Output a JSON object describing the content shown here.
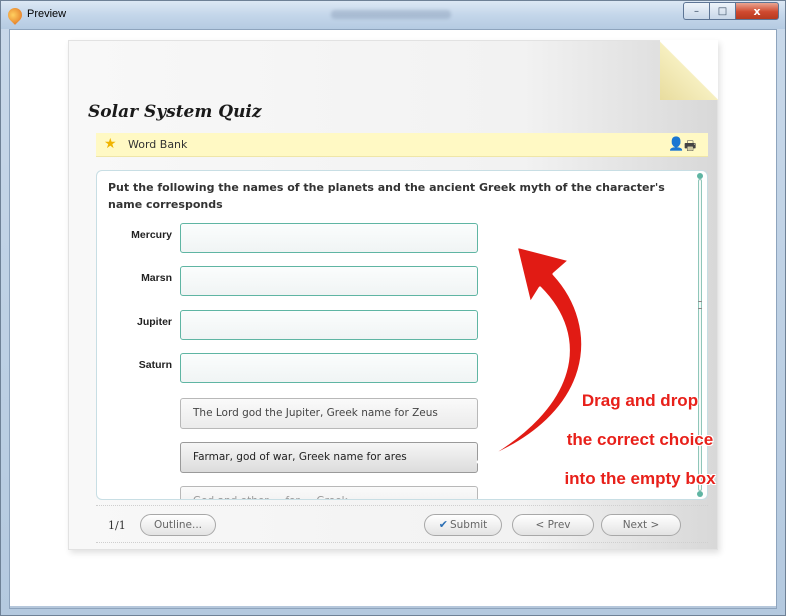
{
  "window": {
    "title": "Preview",
    "controls": {
      "minimize": "–",
      "maximize": "□",
      "close": "x"
    }
  },
  "quiz": {
    "title": "Solar System Quiz",
    "word_bank_label": "Word Bank",
    "question": "Put the following the names of the planets and the ancient Greek myth of the character's name corresponds",
    "rows": [
      {
        "label": "Mercury",
        "value": ""
      },
      {
        "label": "Marsn",
        "value": ""
      },
      {
        "label": "Jupiter",
        "value": ""
      },
      {
        "label": "Saturn",
        "value": ""
      }
    ],
    "choices": [
      "The Lord god the Jupiter, Greek name for Zeus",
      "Farmar, god of war, Greek name for ares",
      "God and other ... for ... Greek ..."
    ]
  },
  "footer": {
    "page": "1/1",
    "outline_label": "Outline...",
    "submit_label": "Submit",
    "prev_label": "< Prev",
    "next_label": "Next >"
  },
  "annotation": {
    "lines": [
      "Drag and drop",
      "the correct choice",
      "into the empty box"
    ],
    "color": "#e8201a"
  },
  "icons": {
    "app": "preview-app-icon",
    "word_bank": "star-icon",
    "user": "person-icon",
    "print": "printer-icon",
    "submit": "checkmark-icon"
  }
}
